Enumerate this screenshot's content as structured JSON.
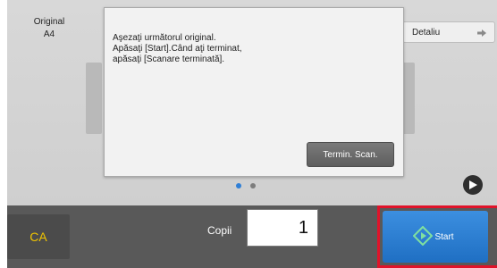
{
  "original": {
    "label": "Original",
    "size": "A4"
  },
  "details_button": {
    "label": "Detaliu"
  },
  "dialog": {
    "line1": "Aşezaţi următorul original.",
    "line2": "Apăsaţi [Start].Când aţi terminat,",
    "line3": "apăsaţi [Scanare terminată].",
    "finish_button": "Termin. Scan."
  },
  "pager": {
    "pages": 2,
    "current": 1
  },
  "bottom": {
    "ca_label": "CA",
    "copies_label": "Copii",
    "copies_value": "1",
    "start_label": "Start"
  },
  "colors": {
    "start_blue": "#2a7fd4",
    "highlight_red": "#e0132a",
    "ca_yellow": "#f0c400",
    "pager_active": "#2f7fd6"
  },
  "icons": {
    "details_arrow": "arrow-right-icon",
    "play": "play-icon",
    "start": "start-diamond-icon"
  }
}
